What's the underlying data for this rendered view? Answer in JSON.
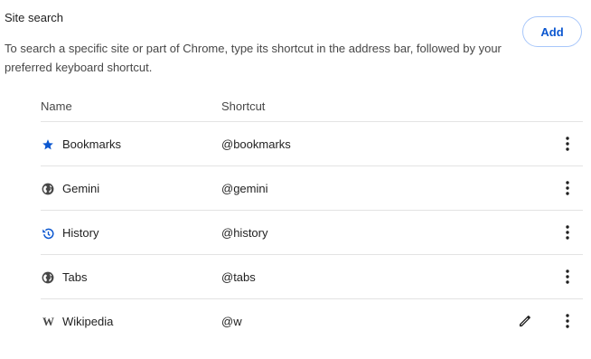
{
  "section": {
    "title": "Site search",
    "description": "To search a specific site or part of Chrome, type its shortcut in the address bar, followed by your preferred keyboard shortcut.",
    "add_label": "Add"
  },
  "table": {
    "headers": {
      "name": "Name",
      "shortcut": "Shortcut"
    },
    "rows": [
      {
        "name": "Bookmarks",
        "shortcut": "@bookmarks",
        "icon": "star-icon"
      },
      {
        "name": "Gemini",
        "shortcut": "@gemini",
        "icon": "globe-icon"
      },
      {
        "name": "History",
        "shortcut": "@history",
        "icon": "history-icon"
      },
      {
        "name": "Tabs",
        "shortcut": "@tabs",
        "icon": "globe-icon"
      },
      {
        "name": "Wikipedia",
        "shortcut": "@w",
        "icon": "wikipedia-icon",
        "wiki_glyph": "W"
      }
    ]
  },
  "colors": {
    "accent": "#0b57d0",
    "icon_gray": "#474747",
    "border": "#e3e3e3"
  }
}
